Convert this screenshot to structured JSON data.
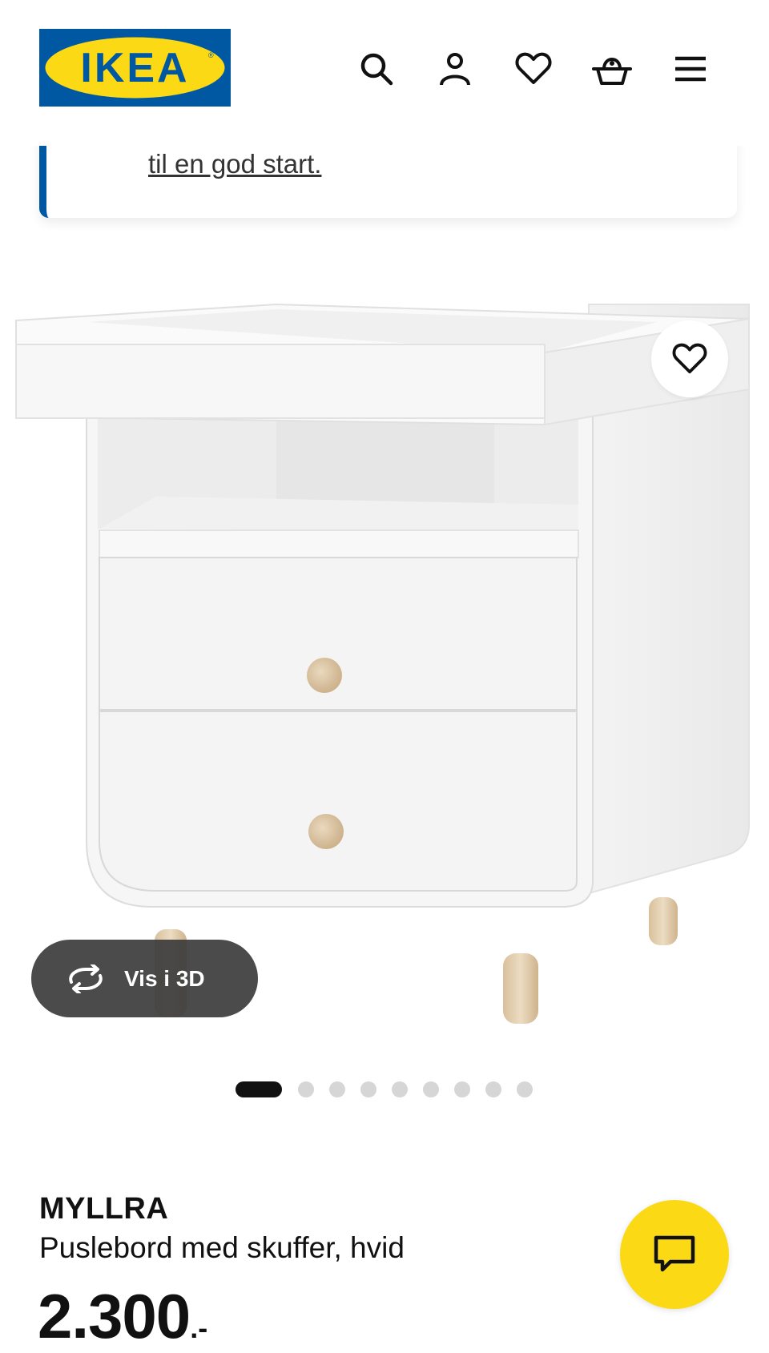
{
  "header": {
    "logo_text": "IKEA",
    "icons": [
      "search-icon",
      "profile-icon",
      "heart-icon",
      "basket-icon",
      "menu-icon"
    ]
  },
  "banner": {
    "link_text": "til en god start."
  },
  "gallery": {
    "view_3d_label": "Vis i 3D",
    "image_count": 9,
    "active_index": 0
  },
  "product": {
    "name": "MYLLRA",
    "description": "Puslebord med skuffer, hvid",
    "price_main": "2.300",
    "price_suffix": ".-"
  },
  "colors": {
    "ikea_blue": "#0058a3",
    "ikea_yellow": "#fbd914",
    "text": "#111111"
  }
}
